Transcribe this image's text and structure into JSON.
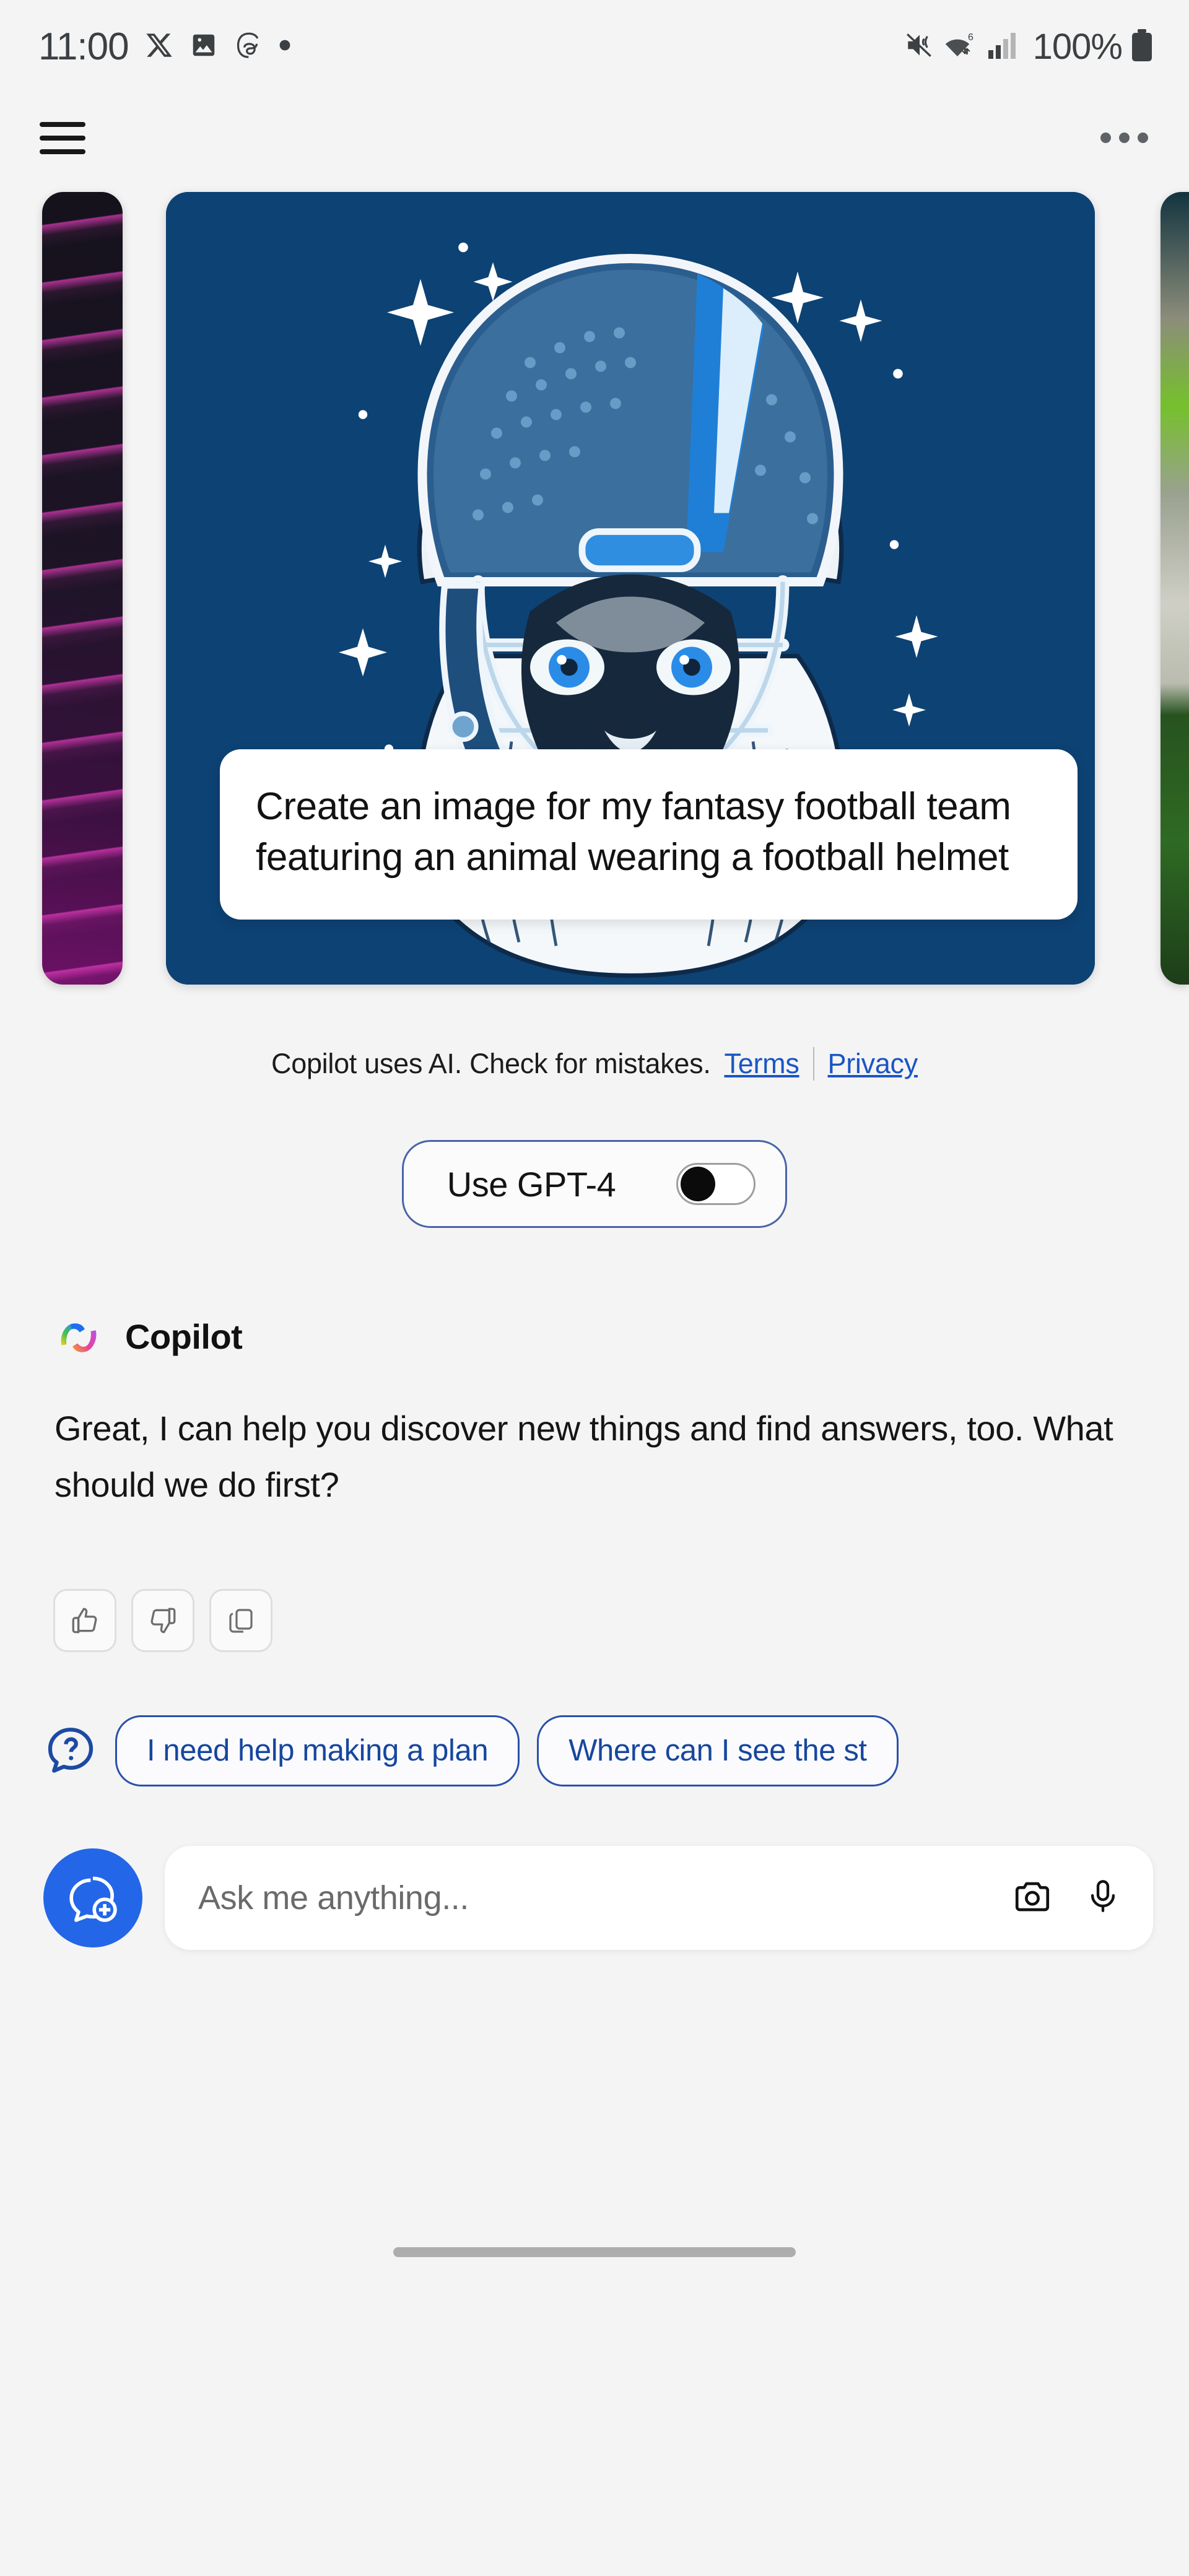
{
  "status_bar": {
    "time": "11:00",
    "battery_percent": "100%",
    "left_icons": [
      "x-twitter-icon",
      "photo-gallery-icon",
      "threads-icon",
      "dot-indicator-icon"
    ],
    "right_icons": [
      "mute-vibrate-icon",
      "wifi-6-icon",
      "cellular-signal-icon",
      "battery-icon"
    ]
  },
  "app_bar": {
    "menu_icon": "hamburger-menu-icon",
    "overflow_icon": "more-options-icon"
  },
  "carousel": {
    "cards": [
      {
        "id": "code-card",
        "kind": "peek-left",
        "art": "dark-purple-code-image"
      },
      {
        "id": "fantasy-football-card",
        "kind": "active",
        "art": "blue-cat-football-helmet-image",
        "prompt": "Create an image for my fantasy football team featuring an animal wearing a football helmet",
        "background_color": "#0d4274"
      },
      {
        "id": "nature-card",
        "kind": "peek-right",
        "art": "green-nature-image"
      }
    ]
  },
  "disclaimer": {
    "text": "Copilot uses AI. Check for mistakes.",
    "terms_label": "Terms",
    "privacy_label": "Privacy",
    "link_color": "#1a56c4"
  },
  "gpt_toggle": {
    "label": "Use GPT-4",
    "state": "off"
  },
  "assistant": {
    "logo": "copilot-logo-icon",
    "name": "Copilot",
    "message": "Great, I can help you discover new things and find answers, too. What should we do first?"
  },
  "feedback": {
    "buttons": [
      {
        "name": "thumbs-up-icon",
        "label": "Like"
      },
      {
        "name": "thumbs-down-icon",
        "label": "Dislike"
      },
      {
        "name": "copy-icon",
        "label": "Copy"
      }
    ]
  },
  "suggestions": {
    "icon": "question-bubble-icon",
    "chips": [
      "I need help making a plan",
      "Where can I see the st"
    ]
  },
  "composer": {
    "new_chat_icon": "new-chat-icon",
    "placeholder": "Ask me anything...",
    "value": "",
    "camera_icon": "camera-icon",
    "mic_icon": "microphone-icon",
    "accent_color": "#2366e8"
  },
  "system_nav": {
    "home_indicator": "home-gesture-bar"
  }
}
